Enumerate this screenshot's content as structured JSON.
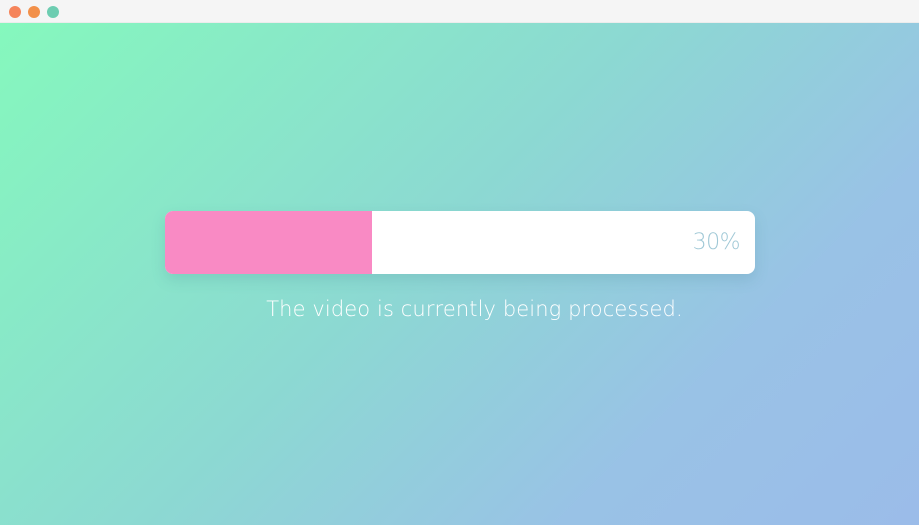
{
  "window": {
    "controls": [
      {
        "name": "close",
        "color": "#f5845a"
      },
      {
        "name": "minimize",
        "color": "#f29049"
      },
      {
        "name": "maximize",
        "color": "#6dcdb1"
      }
    ]
  },
  "progress": {
    "value_percent": 35,
    "label": "30%",
    "fill_color": "#f98ac4",
    "track_color": "#ffffff",
    "label_color": "#9fc8d6"
  },
  "status": {
    "message": "The video is currently being processed."
  },
  "background": {
    "gradient_start": "#85f8bd",
    "gradient_end": "#9bbce9"
  }
}
